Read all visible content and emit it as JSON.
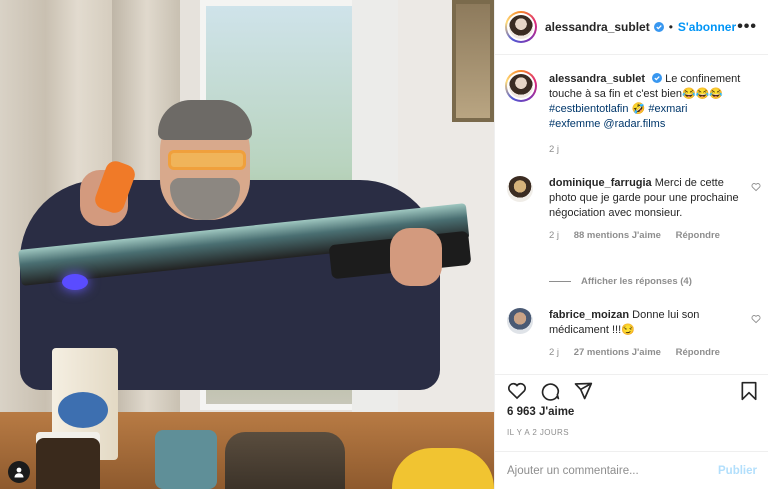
{
  "header": {
    "username": "alessandra_sublet",
    "separator": "•",
    "follow_label": "S'abonner",
    "more_label": "•••"
  },
  "caption": {
    "username": "alessandra_sublet",
    "text": "Le confinement touche à sa fin et c'est bien😂😂😂",
    "tag1": "#cestbientotlafin",
    "emoji": "🤣",
    "tag2": "#exmari",
    "tag3": "#exfemme",
    "tag4": "@radar.films",
    "age": "2 j"
  },
  "comments": [
    {
      "username": "dominique_farrugia",
      "text": "Merci de cette photo que je garde pour une prochaine négociation avec monsieur.",
      "age": "2 j",
      "likes": "88 mentions J'aime",
      "reply_label": "Répondre"
    },
    {
      "username": "fabrice_moizan",
      "text": "Donne lui son médicament !!!😏",
      "age": "2 j",
      "likes": "27 mentions J'aime",
      "reply_label": "Répondre"
    }
  ],
  "view_replies_label": "Afficher les réponses (4)",
  "actions": {
    "like_icon": "heart-icon",
    "comment_icon": "comment-icon",
    "share_icon": "share-icon",
    "save_icon": "bookmark-icon"
  },
  "likes_count": "6 963 J'aime",
  "timestamp": "IL Y A 2 JOURS",
  "add_comment": {
    "placeholder": "Ajouter un commentaire...",
    "post_label": "Publier"
  },
  "colors": {
    "link_blue": "#0095f6",
    "tag_blue": "#00376b",
    "muted": "#8e8e8e"
  }
}
